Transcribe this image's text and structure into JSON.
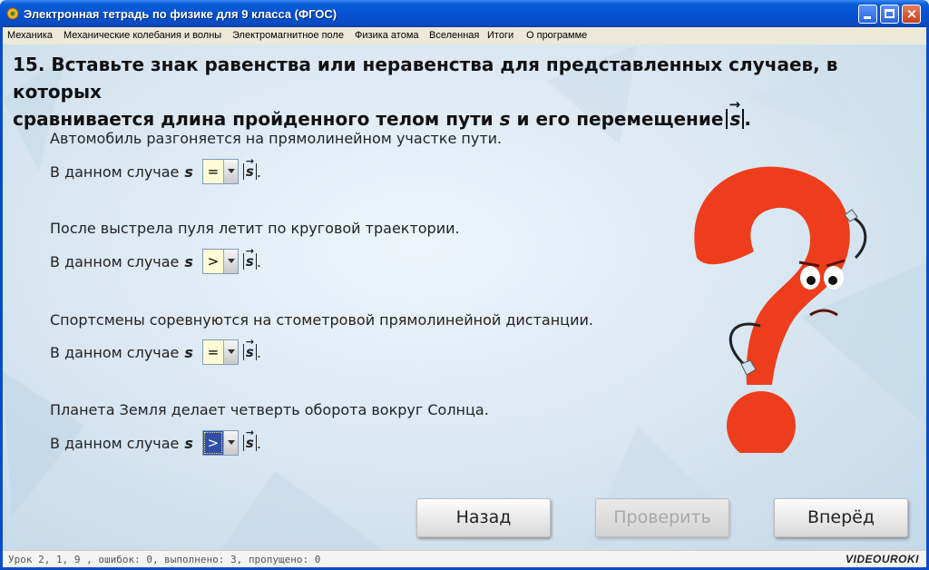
{
  "window": {
    "title": "Электронная тетрадь по физике для 9 класса (ФГОС)"
  },
  "menu": [
    {
      "label": "Механика"
    },
    {
      "label": "Механические колебания и волны"
    },
    {
      "label": "Электромагнитное поле"
    },
    {
      "label": "Физика атома"
    },
    {
      "label": "Вселенная"
    },
    {
      "label": "Итоги"
    },
    {
      "label": "О программе"
    }
  ],
  "question": {
    "line1": "15. Вставьте знак равенства или неравенства для представленных случаев, в которых",
    "line2_a": "сравнивается длина пройденного телом пути",
    "var_s": "s",
    "line2_b": "и его перемещение",
    "line2_end": "."
  },
  "cases": [
    {
      "text": "Автомобиль разгоняется на прямолинейном участке пути.",
      "prefix": "В данном случае",
      "var": "s",
      "value": "=",
      "suffix": "."
    },
    {
      "text": "После выстрела пуля летит по круговой траектории.",
      "prefix": "В данном случае",
      "var": "s",
      "value": ">",
      "suffix": "."
    },
    {
      "text": "Спортсмены соревнуются на стометровой прямолинейной дистанции.",
      "prefix": "В данном случае",
      "var": "s",
      "value": "=",
      "suffix": "."
    },
    {
      "text": "Планета Земля делает четверть оборота вокруг Солнца.",
      "prefix": "В данном случае",
      "var": "s",
      "value": ">",
      "suffix": "."
    }
  ],
  "buttons": {
    "back": "Назад",
    "check": "Проверить",
    "next": "Вперёд"
  },
  "status": {
    "text": "Урок 2, 1, 9 , ошибок: 0, выполнено: 3, пропущено: 0",
    "brand": "VIDEOUROKI"
  },
  "colors": {
    "title_bar": "#0551d1",
    "mascot": "#ee3d1c",
    "selected_combo": "#2f4fa6",
    "combo_value_bg": "#fffbd6"
  },
  "icons": [
    "app-icon",
    "minimize-icon",
    "maximize-icon",
    "close-icon",
    "dropdown-arrow-icon",
    "question-mark-mascot"
  ]
}
